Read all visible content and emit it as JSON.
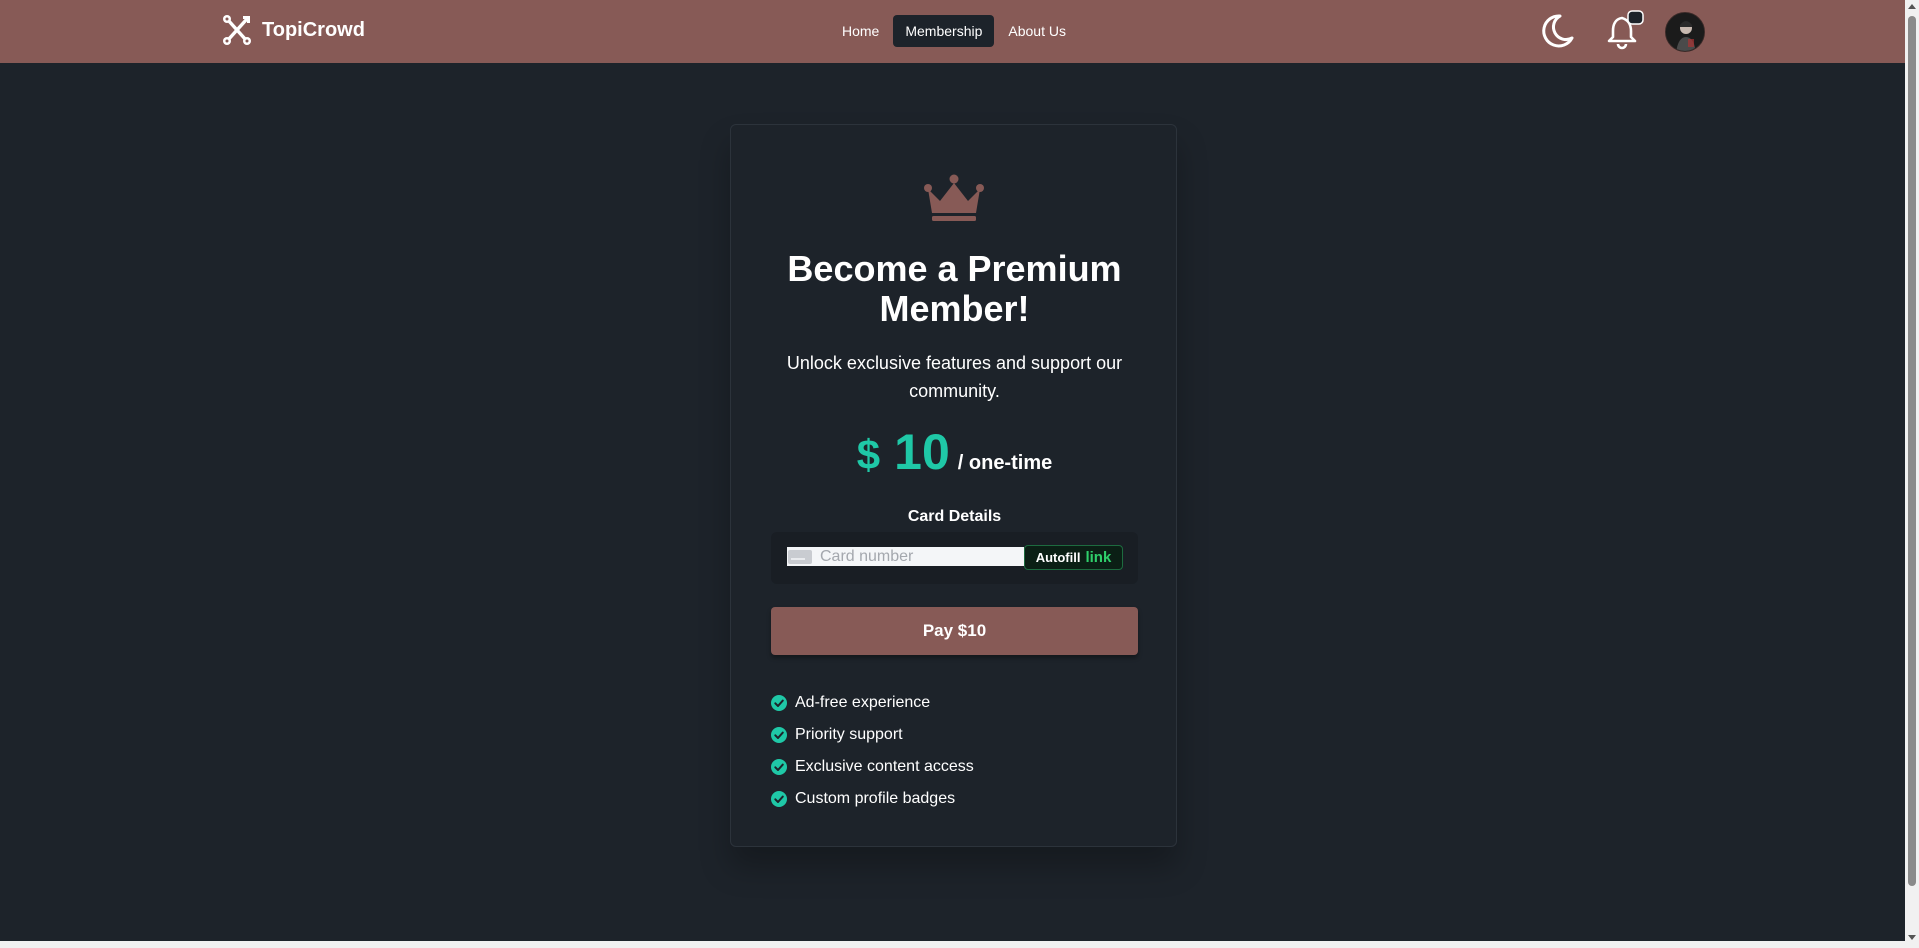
{
  "brand": {
    "name": "TopiCrowd",
    "icon": "tools-icon"
  },
  "nav": {
    "links": [
      {
        "label": "Home",
        "active": false
      },
      {
        "label": "Membership",
        "active": true
      },
      {
        "label": "About Us",
        "active": false
      }
    ]
  },
  "header_icons": [
    "moon-icon",
    "bell-icon",
    "avatar"
  ],
  "card": {
    "icon": "crown-icon",
    "title": "Become a Premium Member!",
    "subtitle": "Unlock exclusive features and support our community.",
    "price": {
      "currency": "$",
      "amount": "10",
      "period": "/ one-time"
    },
    "card_label": "Card Details",
    "card_input": {
      "placeholder": "Card number",
      "value": ""
    },
    "autofill": {
      "text": "Autofill",
      "link": "link"
    },
    "pay_button": "Pay $10",
    "features": [
      "Ad-free experience",
      "Priority support",
      "Exclusive content access",
      "Custom profile badges"
    ]
  },
  "colors": {
    "navbar": "#875a56",
    "background": "#1d232a",
    "accent_price": "#1fc8a7",
    "check": "#1fc8a7",
    "pay_button": "#875a56",
    "link_green": "#2fd06b"
  }
}
